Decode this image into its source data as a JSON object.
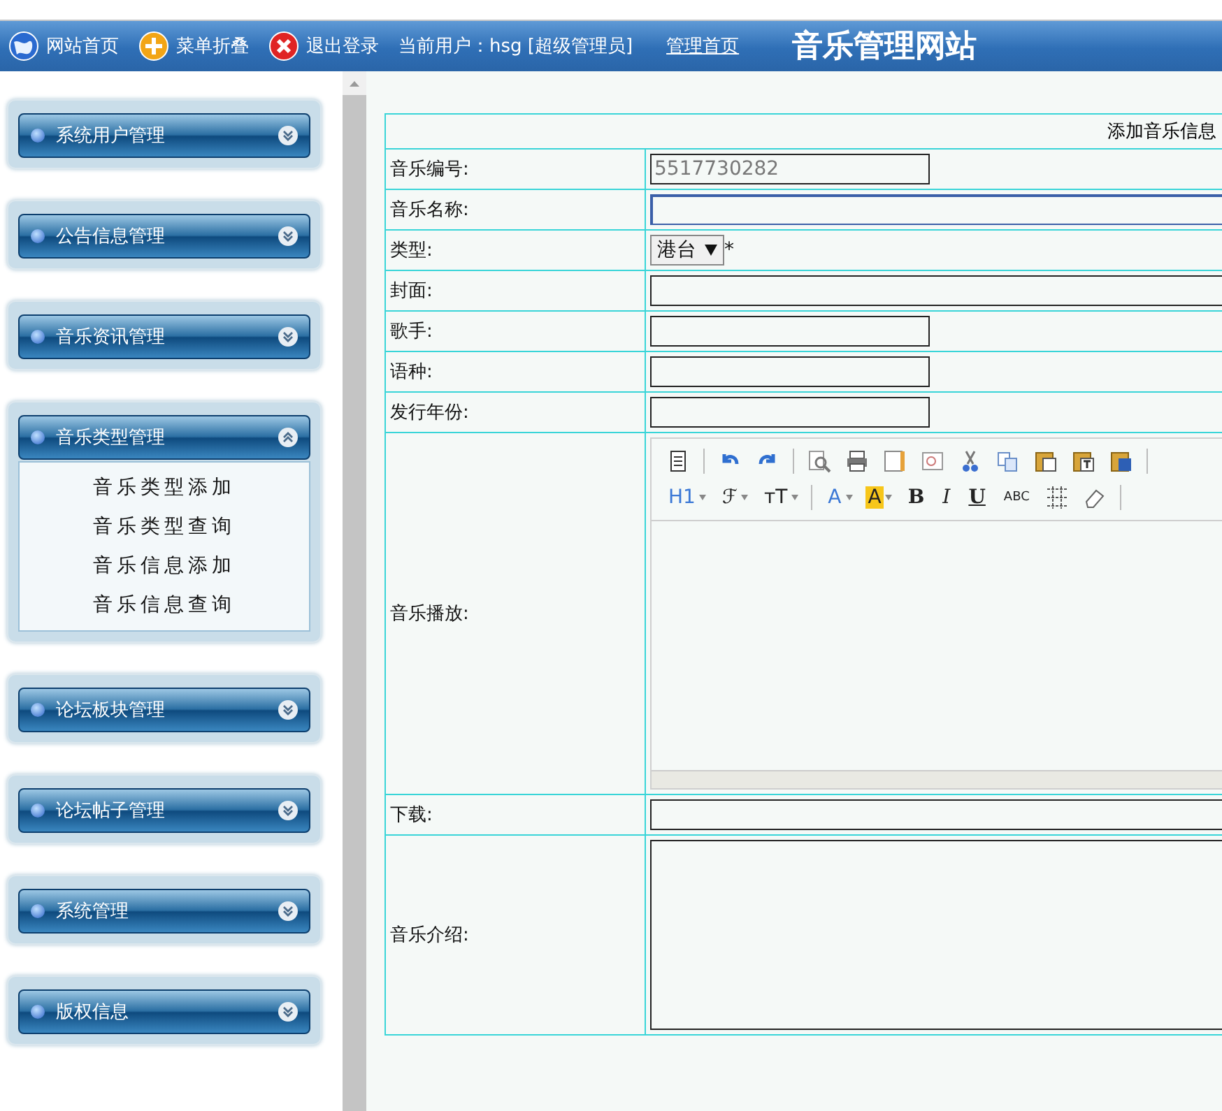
{
  "header": {
    "links": [
      {
        "kind": "home",
        "label": "网站首页"
      },
      {
        "kind": "collapse",
        "label": "菜单折叠"
      },
      {
        "kind": "logout",
        "label": "退出登录"
      }
    ],
    "current_user": "当前用户：hsg [超级管理员]",
    "admin_home": "管理首页",
    "site_title": "音乐管理网站"
  },
  "sidebar": {
    "sections": [
      {
        "title": "系统用户管理",
        "expanded": false
      },
      {
        "title": "公告信息管理",
        "expanded": false
      },
      {
        "title": "音乐资讯管理",
        "expanded": false
      },
      {
        "title": "音乐类型管理",
        "expanded": true,
        "items": [
          "音乐类型添加",
          "音乐类型查询",
          "音乐信息添加",
          "音乐信息查询"
        ]
      },
      {
        "title": "论坛板块管理",
        "expanded": false
      },
      {
        "title": "论坛帖子管理",
        "expanded": false
      },
      {
        "title": "系统管理",
        "expanded": false
      },
      {
        "title": "版权信息",
        "expanded": false
      }
    ]
  },
  "form": {
    "title": "添加音乐信息",
    "rows": [
      {
        "label": "音乐编号:",
        "kind": "short",
        "value": "5517730282",
        "focused": false
      },
      {
        "label": "音乐名称:",
        "kind": "wide",
        "focused": true
      },
      {
        "label": "类型:",
        "kind": "select",
        "value": "港台",
        "required": "*"
      },
      {
        "label": "封面:",
        "kind": "wide",
        "focused": false
      },
      {
        "label": "歌手:",
        "kind": "short",
        "focused": false
      },
      {
        "label": "语种:",
        "kind": "short",
        "focused": false
      },
      {
        "label": "发行年份:",
        "kind": "short",
        "focused": false
      },
      {
        "label": "音乐播放:",
        "kind": "editor",
        "toolbar_text": [
          "H1",
          "ℱ",
          "тT",
          "A",
          "A",
          "B",
          "I",
          "U",
          "ABC"
        ]
      },
      {
        "label": "下载:",
        "kind": "wide",
        "focused": false
      },
      {
        "label": "音乐介绍:",
        "kind": "textarea"
      }
    ]
  }
}
